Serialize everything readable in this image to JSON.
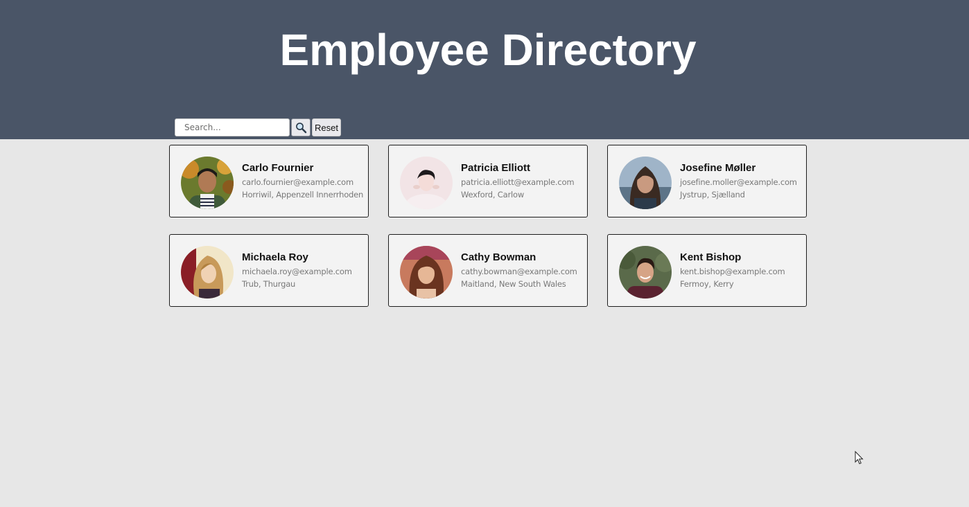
{
  "header": {
    "title": "Employee Directory",
    "background": "#4a5567"
  },
  "search": {
    "placeholder": "Search...",
    "value": "",
    "search_icon": "magnifier-icon",
    "reset_label": "Reset"
  },
  "employees": [
    {
      "name": "Carlo Fournier",
      "email": "carlo.fournier@example.com",
      "location": "Horriwil, Appenzell Innerrhoden"
    },
    {
      "name": "Patricia Elliott",
      "email": "patricia.elliott@example.com",
      "location": "Wexford, Carlow"
    },
    {
      "name": "Josefine Møller",
      "email": "josefine.moller@example.com",
      "location": "Jystrup, Sjælland"
    },
    {
      "name": "Michaela Roy",
      "email": "michaela.roy@example.com",
      "location": "Trub, Thurgau"
    },
    {
      "name": "Cathy Bowman",
      "email": "cathy.bowman@example.com",
      "location": "Maitland, New South Wales"
    },
    {
      "name": "Kent Bishop",
      "email": "kent.bishop@example.com",
      "location": "Fermoy, Kerry"
    }
  ],
  "colors": {
    "page_background": "#e7e7e7",
    "card_background": "#f3f3f3",
    "card_border": "#1d1d1d",
    "secondary_text": "#787878"
  }
}
